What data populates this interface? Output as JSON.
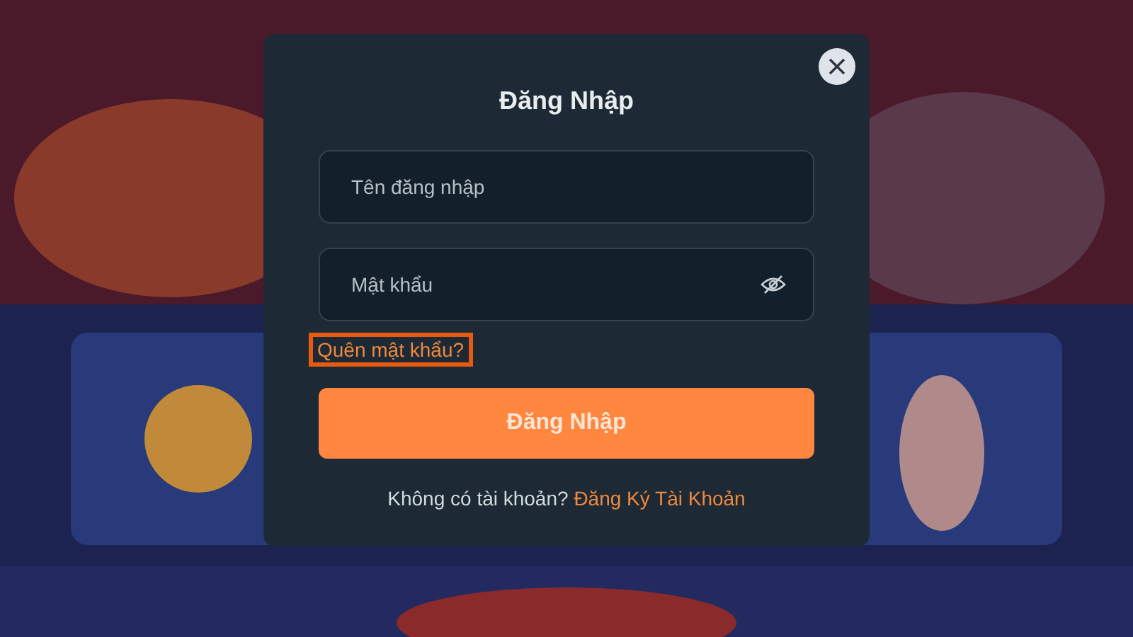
{
  "dialog": {
    "title": "Đăng Nhập",
    "fields": [
      {
        "kind": "text",
        "placeholder": "Tên đăng nhập"
      },
      {
        "kind": "password",
        "placeholder": "Mật khẩu",
        "password_hidden": true
      }
    ],
    "forgot_link": {
      "label": "Quên mật khẩu?",
      "highlighted": true
    },
    "submit": "Đăng Nhập",
    "signup": {
      "prompt": "Không có tài khoản?",
      "link": "Đăng Ký Tài Khoản"
    }
  }
}
